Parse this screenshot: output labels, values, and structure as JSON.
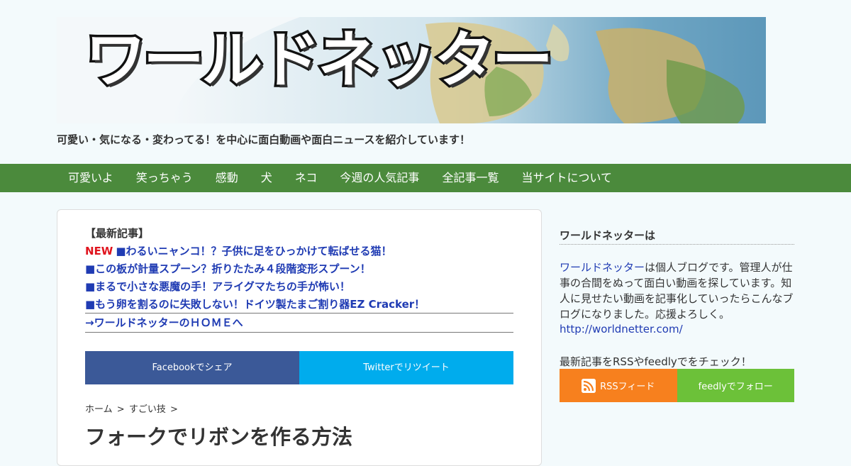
{
  "header": {
    "banner_title": "ワールドネッター",
    "tagline": "可愛い・気になる・変わってる！を中心に面白動画や面白ニュースを紹介しています！"
  },
  "nav": {
    "items": [
      "可愛いよ",
      "笑っちゃう",
      "感動",
      "犬",
      "ネコ",
      "今週の人気記事",
      "全記事一覧",
      "当サイトについて"
    ]
  },
  "latest": {
    "heading": "【最新記事】",
    "new_badge": "NEW",
    "items": [
      "■わるいニャンコ！？子供に足をひっかけて転ばせる猫！",
      "■この板が計量スプーン？折りたたみ４段階変形スプーン！",
      "■まるで小さな悪魔の手！アライグマたちの手が怖い！",
      "■もう卵を割るのに失敗しない！ドイツ製たまご割り器EZ Cracker！"
    ],
    "home_link": "→ワールドネッターのＨＯＭＥへ"
  },
  "share": {
    "facebook_label": "Facebookでシェア",
    "twitter_label": "Twitterでリツイート"
  },
  "breadcrumb": {
    "home": "ホーム",
    "separator": ">",
    "category": "すごい技"
  },
  "article": {
    "title": "フォークでリボンを作る方法"
  },
  "sidebar": {
    "heading": "ワールドネッターは",
    "blog_name_link": "ワールドネッター",
    "description": "は個人ブログです。管理人が仕事の合間をぬって面白い動画を探しています。知人に見せたい動画を記事化していったらこんなブログになりました。応援よろしく。",
    "url": "http://worldnetter.com/",
    "check_text": "最新記事をRSSやfeedlyでをチェック！",
    "rss_label": "RSSフィード",
    "feedly_label": "feedlyでフォロー"
  },
  "colors": {
    "nav_bg": "#4b8a3c",
    "link": "#1f3bb3",
    "new_badge": "#e0141e",
    "facebook": "#3b5998",
    "twitter": "#00aced",
    "rss": "#f7801e",
    "feedly": "#6cc139"
  }
}
